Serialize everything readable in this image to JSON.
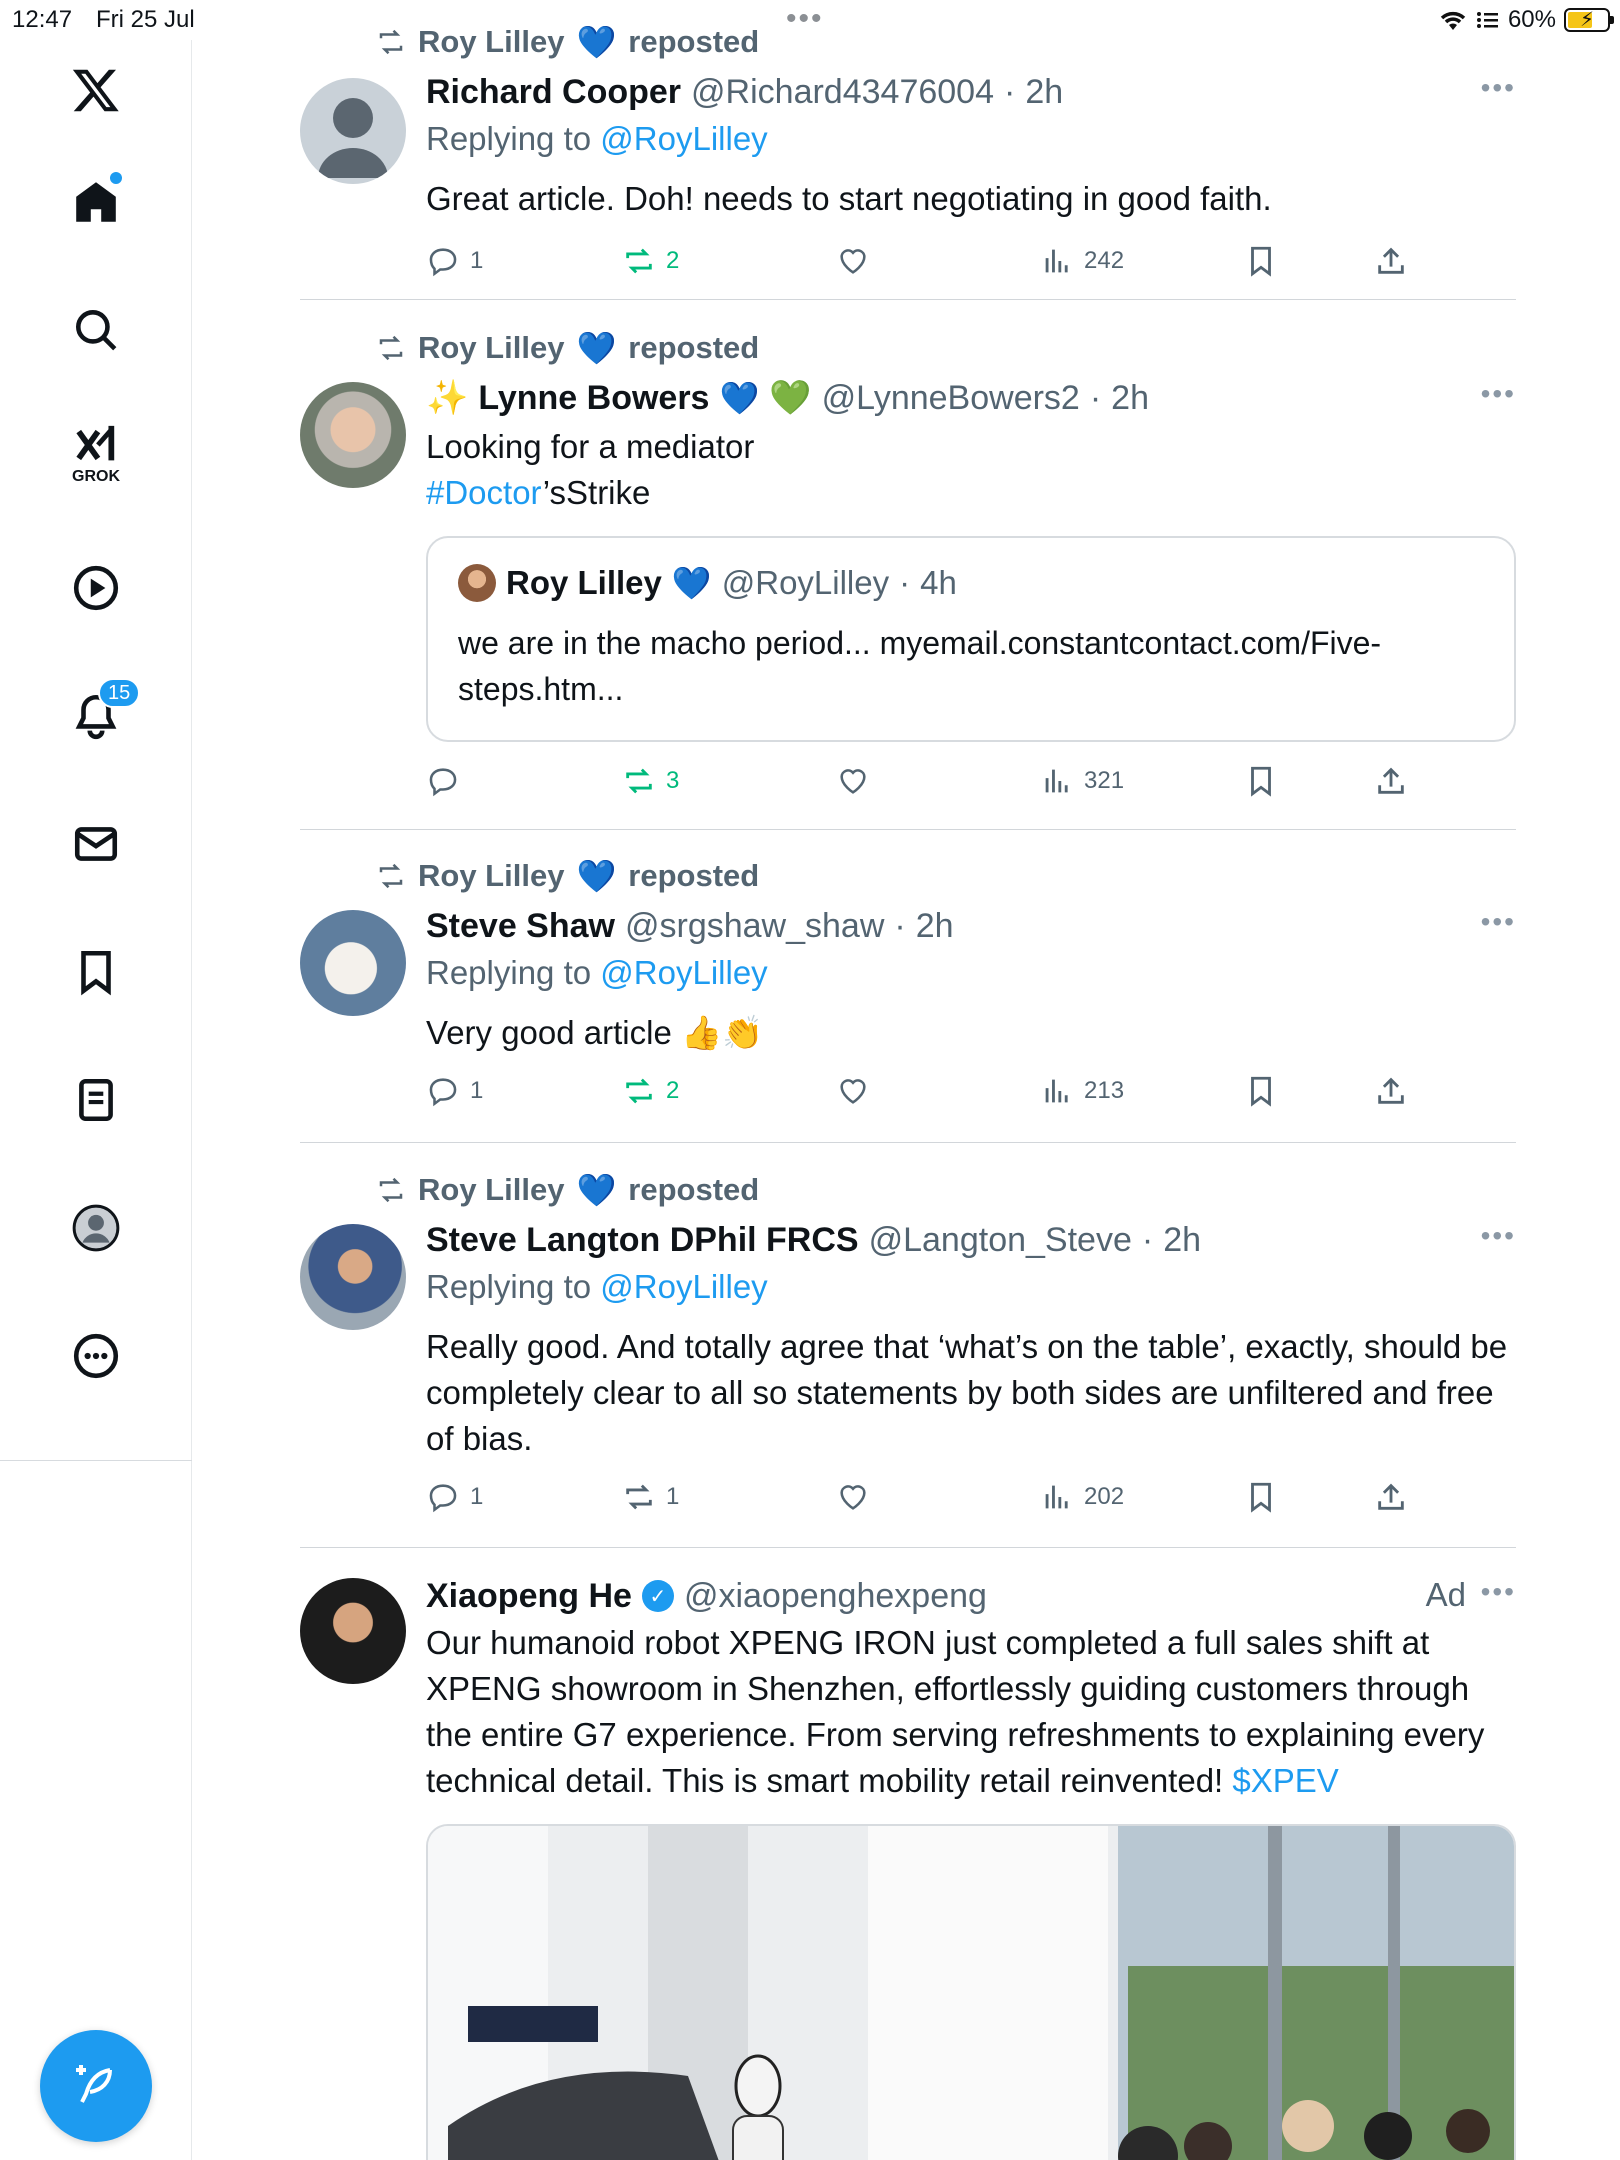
{
  "status_bar": {
    "time": "12:47",
    "date": "Fri 25 Jul",
    "battery": "60%"
  },
  "sidebar": {
    "grok_label": "GROK",
    "notification_count": "15",
    "items": [
      "x-logo",
      "home",
      "search",
      "grok",
      "videos",
      "notifications",
      "messages",
      "bookmarks",
      "lists",
      "profile",
      "more"
    ]
  },
  "posts": [
    {
      "reposted_by": "Roy Lilley",
      "reposted_label": "reposted",
      "author": "Richard Cooper",
      "handle": "@Richard43476004",
      "time": "2h",
      "replying_label": "Replying to",
      "replying_to": "@RoyLilley",
      "text": "Great article. Doh! needs to start negotiating in good faith.",
      "replies": "1",
      "reposts": "2",
      "likes": "",
      "views": "242"
    },
    {
      "reposted_by": "Roy Lilley",
      "reposted_label": "reposted",
      "author_prefix": "✨",
      "author": "Lynne Bowers",
      "handle": "@LynneBowers2",
      "time": "2h",
      "text_line1": "Looking for a mediator",
      "hashtag": "#Doctor",
      "text_after_hashtag": "’sStrike",
      "quote": {
        "author": "Roy Lilley",
        "handle": "@RoyLilley",
        "time": "4h",
        "text": "we are in the macho period... myemail.constantcontact.com/Five-steps.htm..."
      },
      "replies": "",
      "reposts": "3",
      "likes": "",
      "views": "321"
    },
    {
      "reposted_by": "Roy Lilley",
      "reposted_label": "reposted",
      "author": "Steve Shaw",
      "handle": "@srgshaw_shaw",
      "time": "2h",
      "replying_label": "Replying to",
      "replying_to": "@RoyLilley",
      "text": "Very good article 👍👏",
      "replies": "1",
      "reposts": "2",
      "likes": "",
      "views": "213"
    },
    {
      "reposted_by": "Roy Lilley",
      "reposted_label": "reposted",
      "author": "Steve Langton DPhil FRCS",
      "handle": "@Langton_Steve",
      "time": "2h",
      "replying_label": "Replying to",
      "replying_to": "@RoyLilley",
      "text": "Really good. And totally agree that ‘what’s on the table’, exactly, should be completely clear to all so statements by both sides are unfiltered and free of bias.",
      "replies": "1",
      "reposts": "1",
      "likes": "",
      "views": "202"
    },
    {
      "author": "Xiaopeng He",
      "handle": "@xiaopenghexpeng",
      "ad_label": "Ad",
      "text": "Our humanoid robot XPENG IRON just completed a full sales shift at XPENG showroom in Shenzhen, effortlessly guiding customers through the entire G7 experience. From serving refreshments to explaining every technical detail. This is smart mobility retail reinvented!",
      "cashtag": "$XPEV"
    }
  ],
  "colors": {
    "accent": "#1d9bf0",
    "repost_green": "#00ba7c",
    "muted": "#536471"
  }
}
